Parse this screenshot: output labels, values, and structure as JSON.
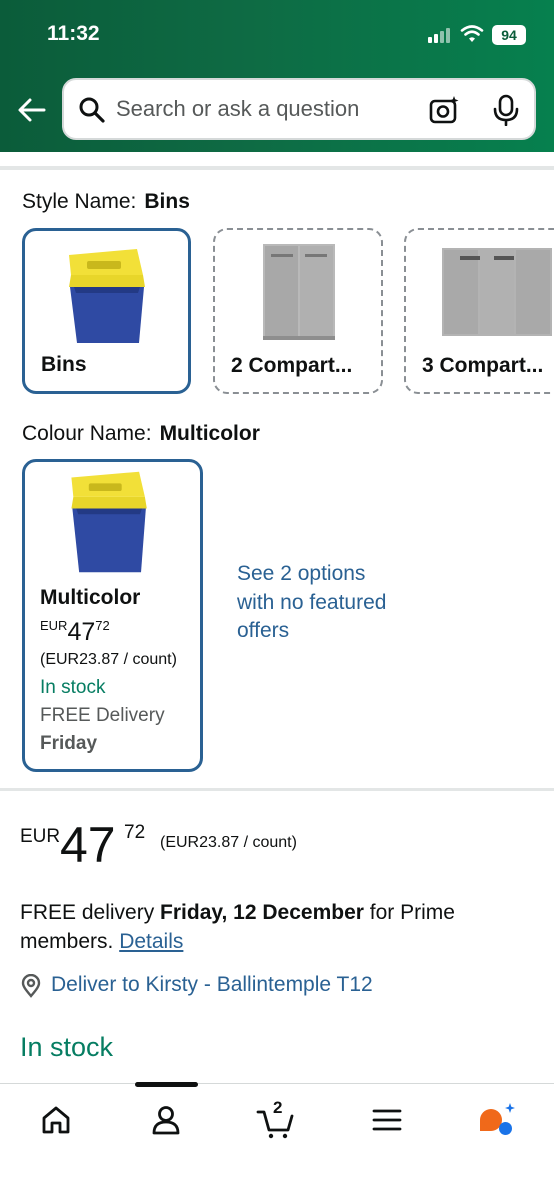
{
  "status_bar": {
    "time": "11:32",
    "battery": "94"
  },
  "header": {
    "search_placeholder": "Search or ask a question",
    "icons": [
      "back-arrow-icon",
      "search-icon",
      "camera-icon",
      "microphone-icon"
    ]
  },
  "style": {
    "label": "Style Name:",
    "selected_value": "Bins",
    "options": [
      {
        "label": "Bins",
        "selected": true
      },
      {
        "label": "2 Compart...",
        "selected": false
      },
      {
        "label": "3 Compart...",
        "selected": false
      }
    ]
  },
  "colour": {
    "label": "Colour Name:",
    "selected_value": "Multicolor",
    "card": {
      "name": "Multicolor",
      "currency": "EUR",
      "price_whole": "47",
      "price_fraction": "72",
      "unit_price": "(EUR23.87 / count)",
      "stock": "In stock",
      "delivery": "FREE Delivery",
      "delivery_day": "Friday"
    },
    "see_options": "See 2 options with no featured offers"
  },
  "price": {
    "currency": "EUR",
    "whole": "47",
    "fraction": "72",
    "unit_price": "(EUR23.87 / count)"
  },
  "delivery": {
    "prefix": "FREE delivery ",
    "date": "Friday, 12 December",
    "suffix": " for Prime members. ",
    "details_link": "Details",
    "deliver_to": "Deliver to Kirsty - Ballintemple T12"
  },
  "availability": "In stock",
  "bottom_nav": {
    "cart_count": "2",
    "items": [
      "home-icon",
      "account-icon",
      "cart-icon",
      "menu-icon",
      "rufus-icon"
    ]
  },
  "colors": {
    "header_green": "#0b5c3a",
    "link_blue": "#2a6193",
    "stock_green": "#067d62",
    "selected_border": "#2a6193"
  }
}
